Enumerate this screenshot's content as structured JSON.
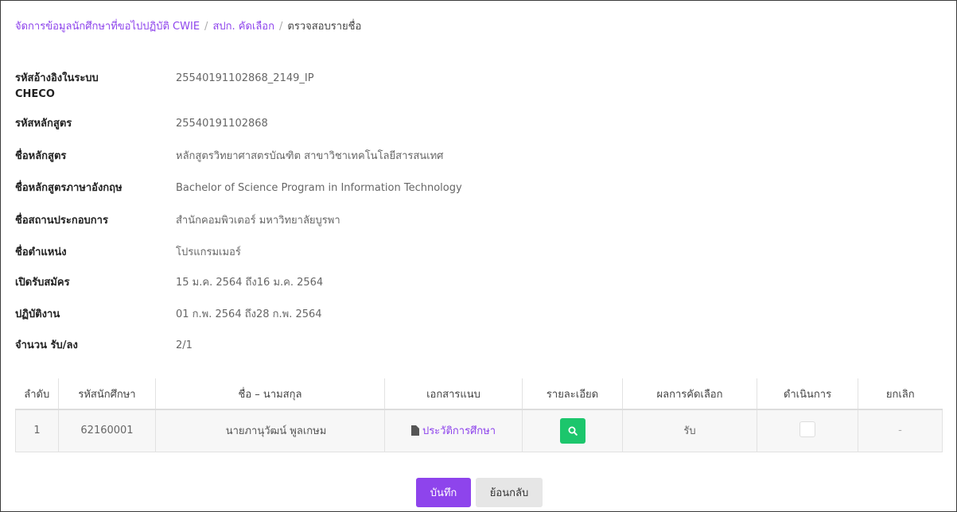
{
  "breadcrumb": {
    "item1": "จัดการข้อมูลนักศึกษาที่ขอไปปฏิบัติ CWIE",
    "item2": "สปก. คัดเลือก",
    "current": "ตรวจสอบรายชื่อ"
  },
  "info": [
    {
      "label": "รหัสอ้างอิงในระบบ CHECO",
      "value": "25540191102868_2149_IP"
    },
    {
      "label": "รหัสหลักสูตร",
      "value": "25540191102868"
    },
    {
      "label": "ชื่อหลักสูตร",
      "value": "หลักสูตรวิทยาศาสตรบัณฑิต สาขาวิชาเทคโนโลยีสารสนเทศ"
    },
    {
      "label": "ชื่อหลักสูตรภาษาอังกฤษ",
      "value": "Bachelor of Science Program in Information Technology"
    },
    {
      "label": "ชื่อสถานประกอบการ",
      "value": "สำนักคอมพิวเตอร์ มหาวิทยาลัยบูรพา"
    },
    {
      "label": "ชื่อตำแหน่ง",
      "value": "โปรแกรมเมอร์"
    },
    {
      "label": "เปิดรับสมัคร",
      "value": "15 ม.ค. 2564 ถึง16 ม.ค. 2564"
    },
    {
      "label": "ปฏิบัติงาน",
      "value": "01 ก.พ. 2564 ถึง28 ก.พ. 2564"
    },
    {
      "label": "จำนวน รับ/ลง",
      "value": "2/1"
    }
  ],
  "table": {
    "headers": [
      "ลำดับ",
      "รหัสนักศึกษา",
      "ชื่อ – นามสกุล",
      "เอกสารแนบ",
      "รายละเอียด",
      "ผลการคัดเลือก",
      "ดำเนินการ",
      "ยกเลิก"
    ],
    "rows": [
      {
        "no": "1",
        "student_id": "62160001",
        "name": "นายภานุวัฒน์ พูลเกษม",
        "attachment": "ประวัติการศึกษา",
        "result": "รับ",
        "cancel": "-"
      }
    ]
  },
  "buttons": {
    "save": "บันทึก",
    "back": "ย้อนกลับ"
  },
  "colors": {
    "accent": "#8e44ec",
    "success": "#1cc66c"
  }
}
